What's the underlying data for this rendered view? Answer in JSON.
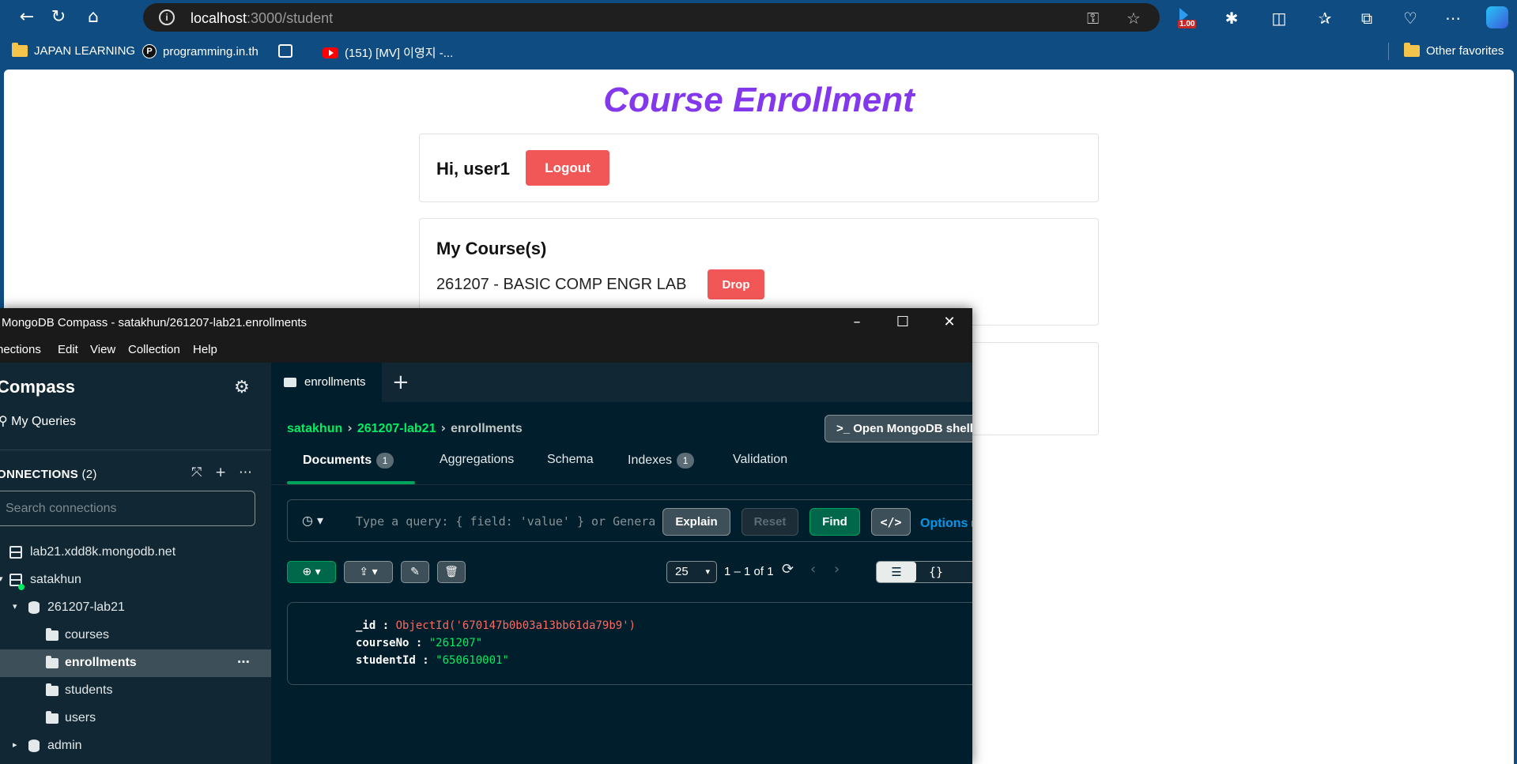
{
  "browser": {
    "address_host": "localhost",
    "address_path": ":3000/student",
    "extension_badge": "1.00",
    "bookmarks": [
      {
        "label": "JAPAN LEARNING",
        "icon": "folder-icon"
      },
      {
        "label": "programming.in.th",
        "icon": "p-logo-icon"
      },
      {
        "label": "",
        "icon": "calendar-icon"
      },
      {
        "label": "(151) [MV] 이영지 -...",
        "icon": "youtube-icon"
      }
    ],
    "other_favorites": "Other favorites"
  },
  "page": {
    "title": "Course Enrollment",
    "greeting": "Hi, user1",
    "logout_label": "Logout",
    "courses_heading": "My Course(s)",
    "courses": [
      {
        "label": "261207 - BASIC COMP ENGR LAB",
        "drop_label": "Drop"
      }
    ],
    "accent_color": "#8338ec",
    "button_color": "#f25757"
  },
  "compass": {
    "window_title": "MongoDB Compass - satakhun/261207-lab21.enrollments",
    "menu": [
      "nections",
      "Edit",
      "View",
      "Collection",
      "Help"
    ],
    "sidebar": {
      "brand": "Compass",
      "my_queries": "My Queries",
      "connections_label": "ONNECTIONS",
      "connections_count": "(2)",
      "search_placeholder": "Search connections",
      "tree": {
        "conn1": "lab21.xdd8k.mongodb.net",
        "conn2": "satakhun",
        "db1": "261207-lab21",
        "collections": [
          "courses",
          "enrollments",
          "students",
          "users"
        ],
        "db2": "admin"
      }
    },
    "tab_label": "enrollments",
    "breadcrumb": [
      "satakhun",
      "261207-lab21",
      "enrollments"
    ],
    "shell_button": ">_  Open MongoDB shell",
    "subtabs": {
      "documents": "Documents",
      "documents_count": "1",
      "aggregations": "Aggregations",
      "schema": "Schema",
      "indexes": "Indexes",
      "indexes_count": "1",
      "validation": "Validation"
    },
    "query": {
      "placeholder": "Type a query: { field: 'value' } or Generate query",
      "explain": "Explain",
      "reset": "Reset",
      "find": "Find",
      "code": "</>",
      "options": "Options ▸"
    },
    "pagination": {
      "page_size": "25",
      "info": "1 – 1 of 1"
    },
    "document": {
      "id_key": "_id :",
      "id_value": "ObjectId('670147b0b03a13bb61da79b9')",
      "course_key": "courseNo :",
      "course_value": "\"261207\"",
      "student_key": "studentId :",
      "student_value": "\"650610001\""
    },
    "colors": {
      "background": "#001e2b",
      "sidebar": "#112733",
      "green": "#00ed64",
      "find_button": "#00684a"
    }
  }
}
